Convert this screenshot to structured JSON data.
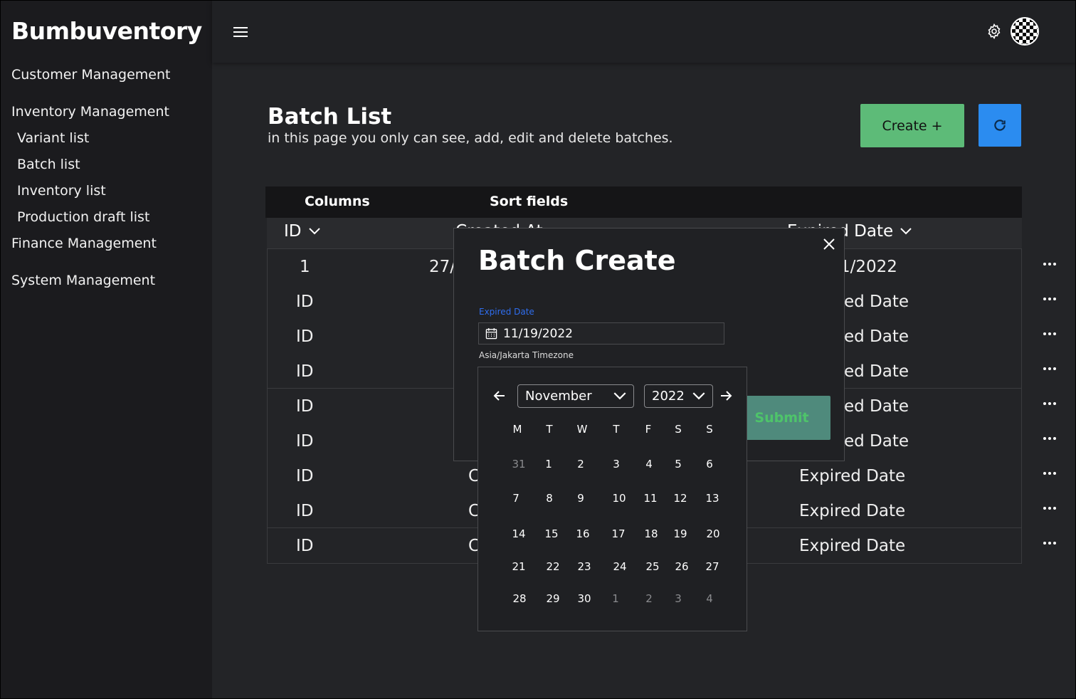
{
  "app": {
    "title": "Bumbuventory"
  },
  "sidebar": {
    "items": [
      {
        "label": "Customer Management"
      },
      {
        "label": "Inventory Management"
      },
      {
        "label": "Variant list"
      },
      {
        "label": "Batch list"
      },
      {
        "label": "Inventory list"
      },
      {
        "label": "Production draft list"
      },
      {
        "label": "Finance Management"
      },
      {
        "label": "System Management"
      }
    ]
  },
  "topbar": {
    "menu_icon": "hamburger-icon",
    "settings_icon": "gear-icon",
    "avatar_icon": "avatar"
  },
  "header": {
    "title": "Batch List",
    "subtitle": "in this page you only can see, add, edit and delete batches.",
    "create_label": "Create +",
    "refresh_icon": "refresh-icon"
  },
  "table": {
    "toolbar": {
      "columns_label": "Columns",
      "sort_label": "Sort fields"
    },
    "headers": {
      "id": "ID",
      "created": "Created At",
      "expired": "Expired Date"
    },
    "rows": [
      {
        "id": "1",
        "created": "27/",
        "expired": "1/2022"
      },
      {
        "id": "ID",
        "created": "",
        "expired": "ed Date"
      },
      {
        "id": "ID",
        "created": "",
        "expired": "ed Date"
      },
      {
        "id": "ID",
        "created": "",
        "expired": "ed Date"
      },
      {
        "id": "ID",
        "created": "",
        "expired": "ed Date"
      },
      {
        "id": "ID",
        "created": "",
        "expired": "ed Date"
      },
      {
        "id": "ID",
        "created": "C",
        "expired": "Expired Date"
      },
      {
        "id": "ID",
        "created": "C",
        "expired": "Expired Date"
      },
      {
        "id": "ID",
        "created": "C",
        "expired": "Expired Date"
      }
    ]
  },
  "modal": {
    "title": "Batch Create",
    "field_label": "Expired Date",
    "date_value": "11/19/2022",
    "timezone": "Asia/Jakarta Timezone",
    "submit_label": "Submit"
  },
  "calendar": {
    "month": "November",
    "year": "2022",
    "weekdays": [
      "M",
      "T",
      "W",
      "T",
      "F",
      "S",
      "S"
    ],
    "weeks": [
      [
        "31",
        "1",
        "2",
        "3",
        "4",
        "5",
        "6"
      ],
      [
        "7",
        "8",
        "9",
        "10",
        "11",
        "12",
        "13"
      ],
      [
        "14",
        "15",
        "16",
        "17",
        "18",
        "19",
        "20"
      ],
      [
        "21",
        "22",
        "23",
        "24",
        "25",
        "26",
        "27"
      ],
      [
        "28",
        "29",
        "30",
        "1",
        "2",
        "3",
        "4"
      ]
    ]
  },
  "colors": {
    "background": "#232427",
    "sidebar": "#1b1b1e",
    "create_button": "#5dbb78",
    "refresh_button": "#2b8cf0",
    "submit_button": "#4f8a7c",
    "field_label": "#2f6ef0"
  }
}
